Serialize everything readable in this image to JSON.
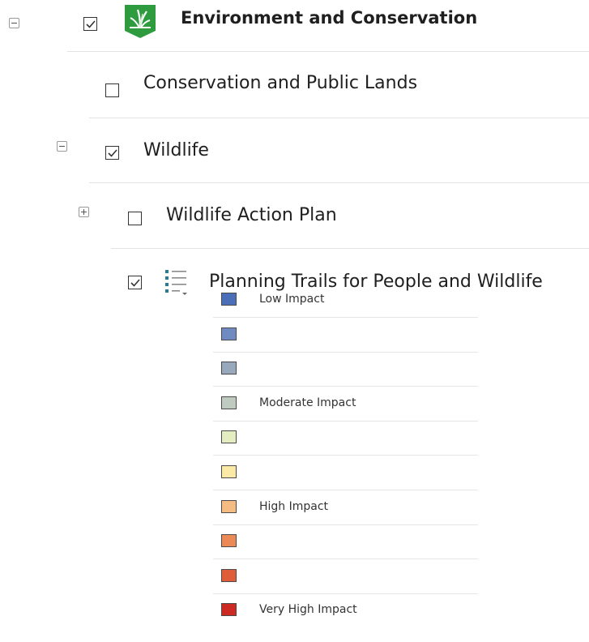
{
  "layers": {
    "environment": {
      "label": "Environment and Conservation",
      "checked": true,
      "expanded": true
    },
    "conservation_public_lands": {
      "label": "Conservation and Public Lands",
      "checked": false
    },
    "wildlife": {
      "label": "Wildlife",
      "checked": true,
      "expanded": true
    },
    "wildlife_action_plan": {
      "label": "Wildlife Action Plan",
      "checked": false,
      "expanded": false
    },
    "planning_trails": {
      "label": "Planning Trails for People and Wildlife",
      "checked": true
    }
  },
  "legend": [
    {
      "label": "Low Impact",
      "color": "#4a6fb8"
    },
    {
      "label": "",
      "color": "#6f8bc1"
    },
    {
      "label": "",
      "color": "#98a8bd"
    },
    {
      "label": "Moderate Impact",
      "color": "#bfcbc0"
    },
    {
      "label": "",
      "color": "#e4edc2"
    },
    {
      "label": "",
      "color": "#fbe9a6"
    },
    {
      "label": "High Impact",
      "color": "#f4bc82"
    },
    {
      "label": "",
      "color": "#ec8a57"
    },
    {
      "label": "",
      "color": "#e05d3a"
    },
    {
      "label": "Very High Impact",
      "color": "#cc2a22"
    }
  ],
  "colors": {
    "group_icon": "#2e9b3f",
    "legend_icon": "#2b7a8f"
  },
  "icons": {
    "environment": "grass-leaf-icon",
    "planning_trails": "legend-list-icon"
  }
}
